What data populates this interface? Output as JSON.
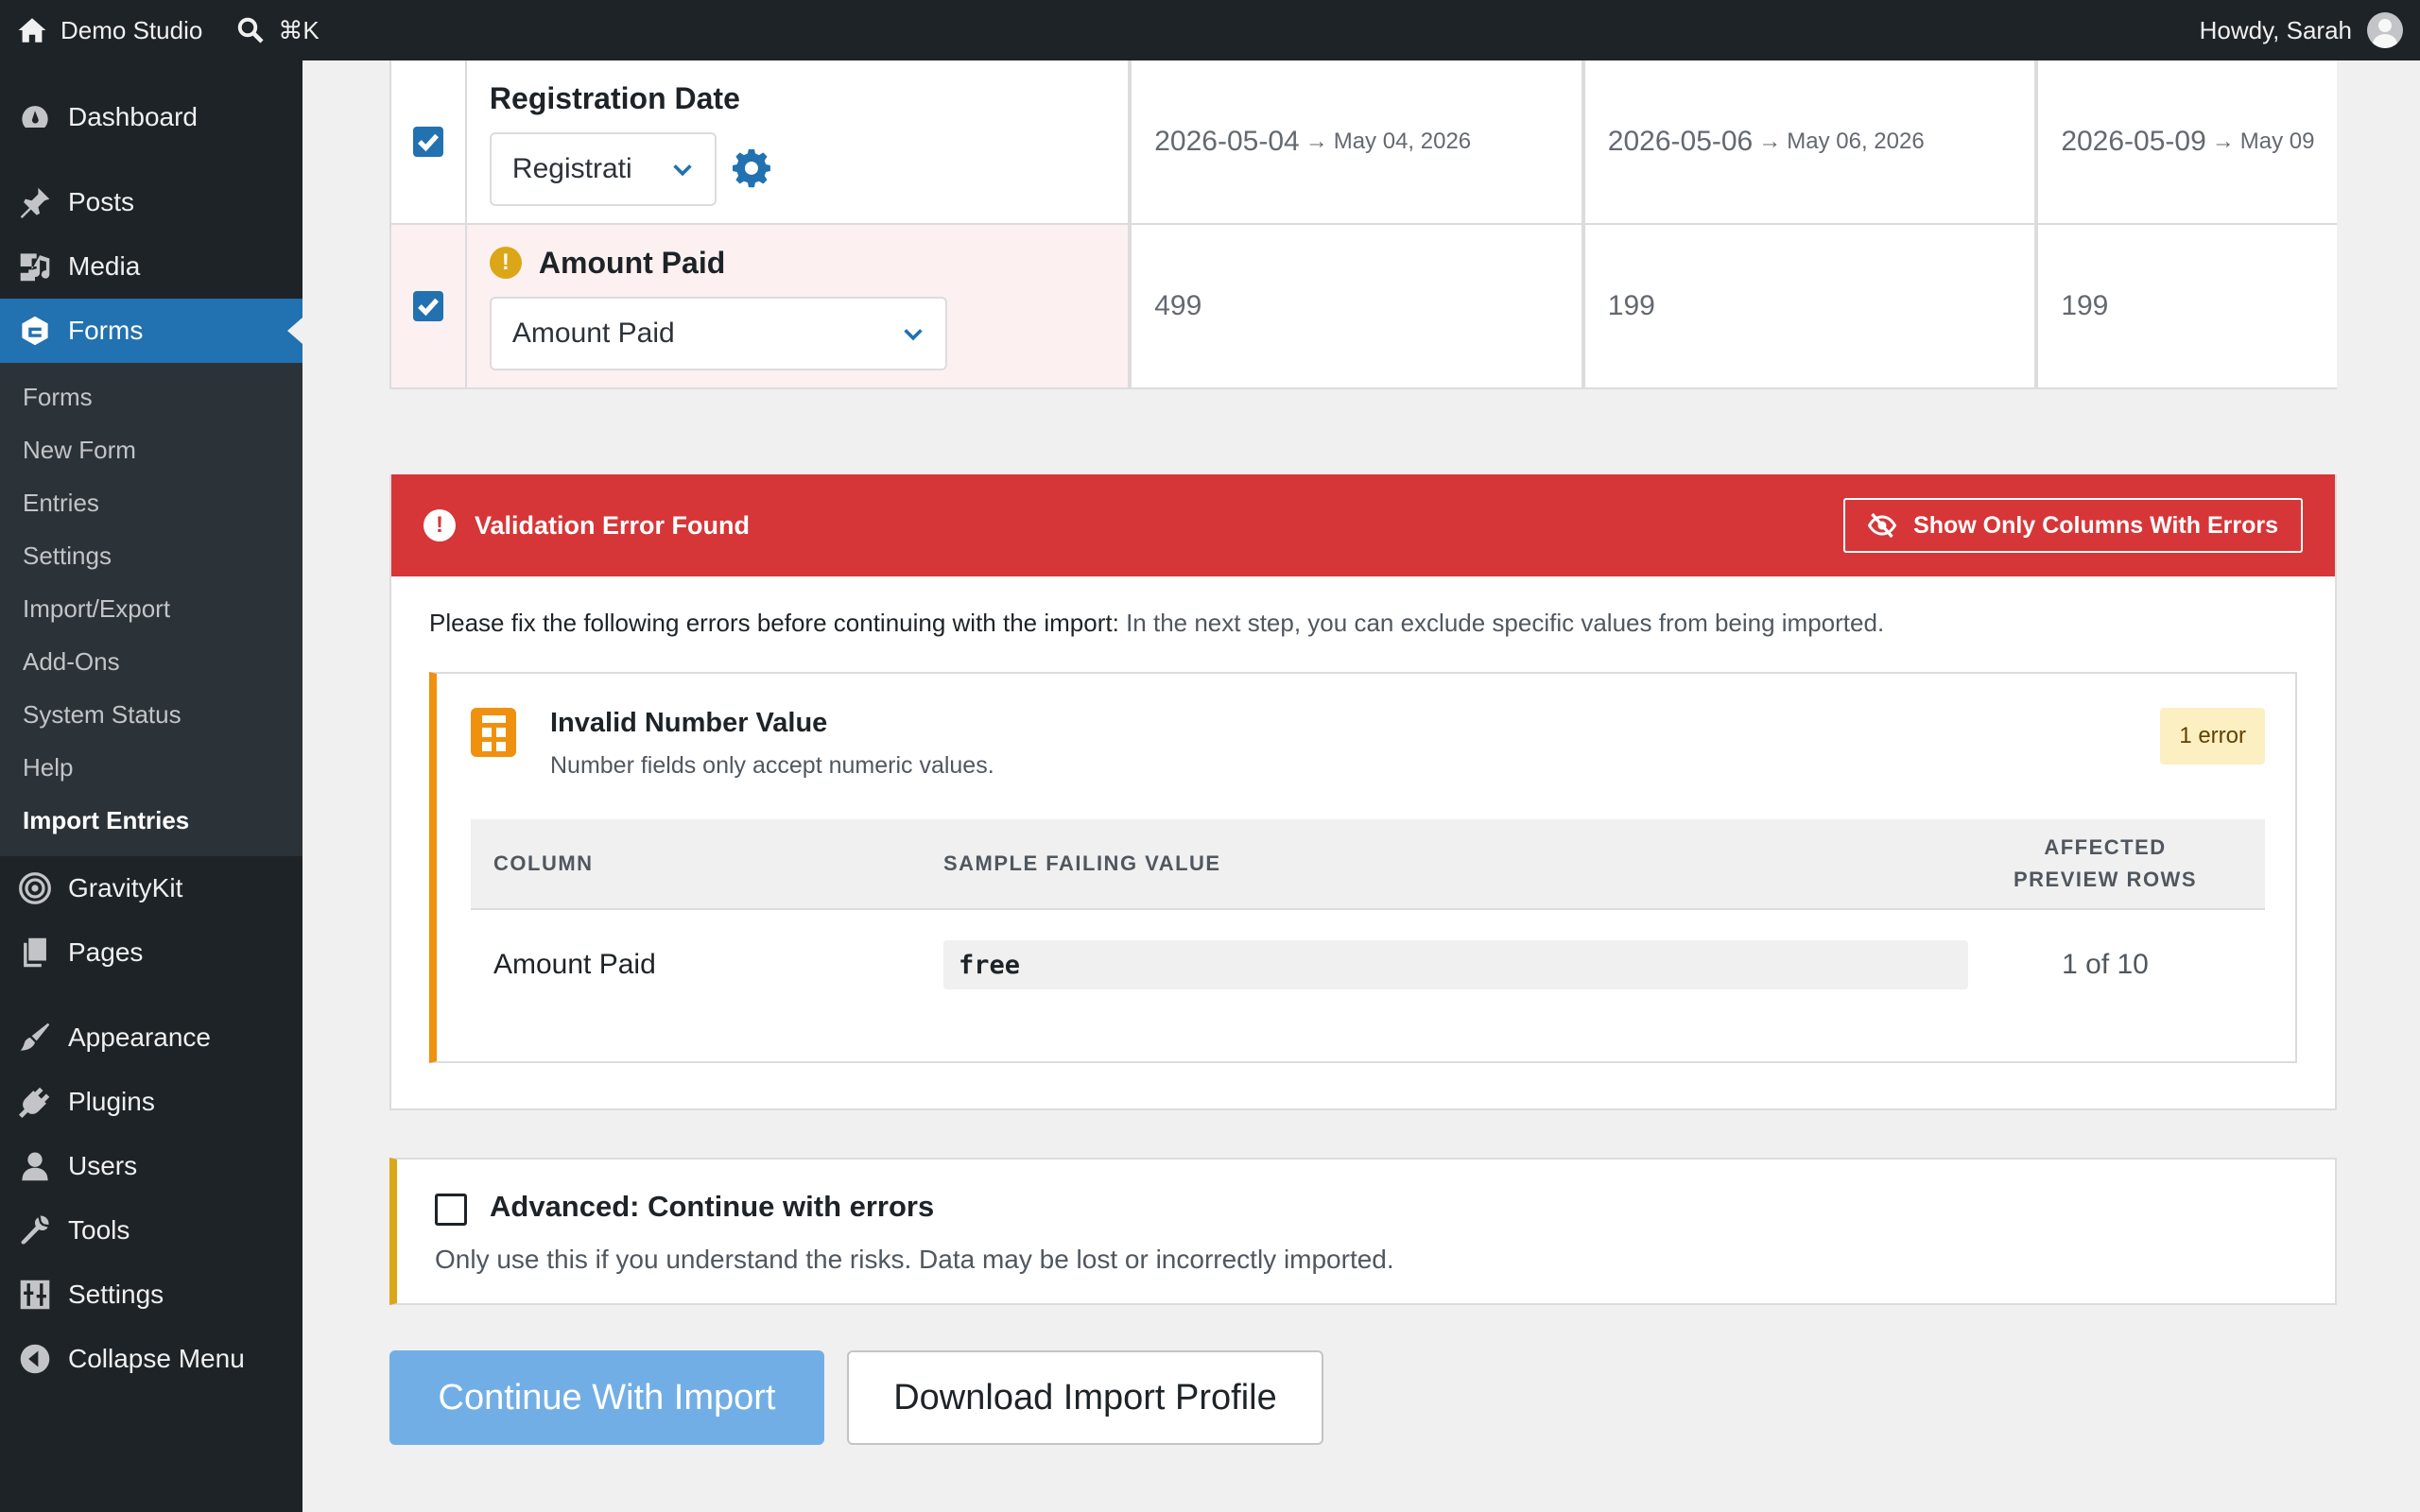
{
  "adminbar": {
    "site_name": "Demo Studio",
    "search_shortcut": "⌘K",
    "greeting": "Howdy, Sarah"
  },
  "sidebar": {
    "menu": [
      {
        "label": "Dashboard",
        "icon": "dashboard-icon"
      },
      {
        "label": "Posts",
        "icon": "pin-icon"
      },
      {
        "label": "Media",
        "icon": "media-icon"
      },
      {
        "label": "Forms",
        "icon": "gravity-forms-icon"
      },
      {
        "label": "GravityKit",
        "icon": "gravitykit-icon"
      },
      {
        "label": "Pages",
        "icon": "pages-icon"
      },
      {
        "label": "Appearance",
        "icon": "brush-icon"
      },
      {
        "label": "Plugins",
        "icon": "plug-icon"
      },
      {
        "label": "Users",
        "icon": "user-icon"
      },
      {
        "label": "Tools",
        "icon": "wrench-icon"
      },
      {
        "label": "Settings",
        "icon": "sliders-icon"
      },
      {
        "label": "Collapse Menu",
        "icon": "collapse-icon"
      }
    ],
    "forms_submenu": [
      "Forms",
      "New Form",
      "Entries",
      "Settings",
      "Import/Export",
      "Add-Ons",
      "System Status",
      "Help",
      "Import Entries"
    ]
  },
  "field_rows": [
    {
      "label": "Registration Date",
      "select_value": "Registrati",
      "values": [
        {
          "raw": "2026-05-04",
          "arrow": "→",
          "formatted": "May 04, 2026"
        },
        {
          "raw": "2026-05-06",
          "arrow": "→",
          "formatted": "May 06, 2026"
        },
        {
          "raw": "2026-05-09",
          "arrow": "→",
          "formatted": "May 09"
        }
      ]
    },
    {
      "label": "Amount Paid",
      "warning": "!",
      "select_value": "Amount Paid",
      "values": [
        "499",
        "199",
        "199"
      ]
    }
  ],
  "validation": {
    "icon": "!",
    "title": "Validation Error Found",
    "toggle_label": "Show Only Columns With Errors",
    "message": "Please fix the following errors before continuing with the import:",
    "message_note": "In the next step, you can exclude specific values from being imported.",
    "error": {
      "title": "Invalid Number Value",
      "subtitle": "Number fields only accept numeric values.",
      "badge": "1 error",
      "columns": {
        "column": "COLUMN",
        "sample": "SAMPLE FAILING VALUE",
        "affected_line1": "AFFECTED",
        "affected_line2": "PREVIEW ROWS"
      },
      "rows": [
        {
          "column": "Amount Paid",
          "sample": "free",
          "affected": "1 of 10"
        }
      ]
    }
  },
  "advanced": {
    "title": "Advanced: Continue with errors",
    "description": "Only use this if you understand the risks. Data may be lost or incorrectly imported."
  },
  "buttons": {
    "continue": "Continue With Import",
    "download": "Download Import Profile"
  },
  "colors": {
    "error_red": "#d63638",
    "primary_blue": "#2271b1",
    "warning_orange": "#f0900f",
    "warning_yellow": "#dba617"
  }
}
